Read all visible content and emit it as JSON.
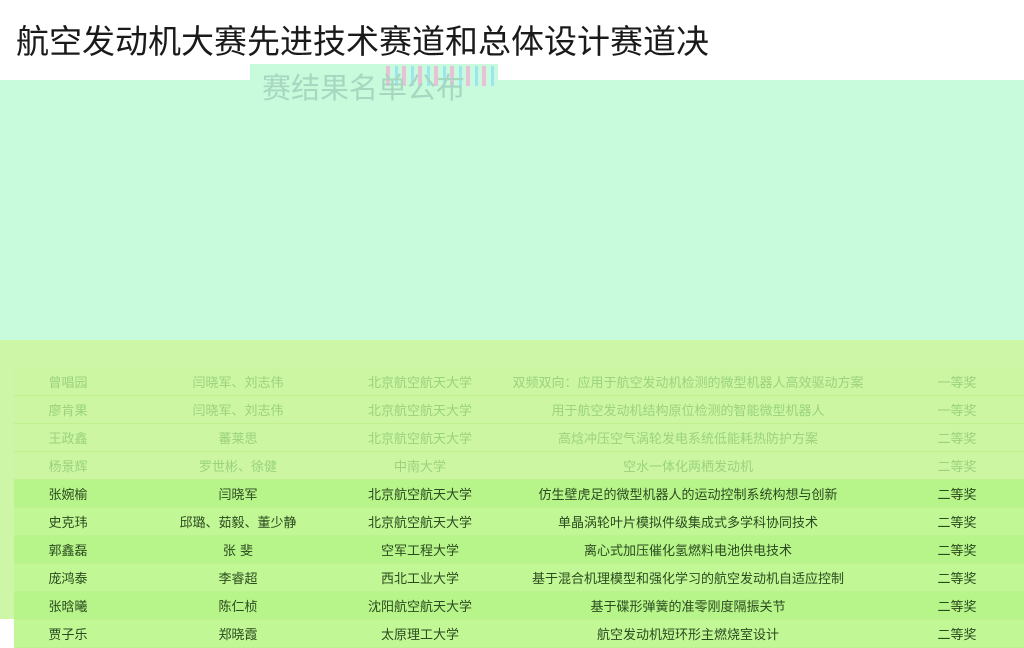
{
  "title": {
    "line1": "航空发动机大赛先进技术赛道和总体设计赛道决",
    "line2": "赛结果名单公布"
  },
  "overlay_title": "赛结果名单公布",
  "faded_row": {
    "name": "曾唱园",
    "advisors": "闫晓军、刘志伟",
    "school": "北京航空航天大学",
    "project": "双频双向：应用于航空发动机检测的微型机器人高效驱动方案",
    "award": "一等奖"
  },
  "table": {
    "rows": [
      {
        "name": "廖肯果",
        "advisors": "闫晓军、刘志伟",
        "school": "北京航空航天大学",
        "project": "用于航空发动机结构原位检测的智能微型机器人",
        "award": "一等奖",
        "style": "light"
      },
      {
        "name": "王政鑫",
        "advisors": "蕃莱思",
        "school": "北京航空航天大学",
        "project": "高焓冲压空气涡轮发电系统低能耗热防护方案",
        "award": "二等奖",
        "style": "light"
      },
      {
        "name": "杨景辉",
        "advisors": "罗世彬、徐健",
        "school": "中南大学",
        "project": "空水一体化两栖发动机",
        "award": "二等奖",
        "style": "light"
      },
      {
        "name": "张婉榆",
        "advisors": "闫晓军",
        "school": "北京航空航天大学",
        "project": "仿生壁虎足的微型机器人的运动控制系统构想与创新",
        "award": "二等奖",
        "style": "strong"
      },
      {
        "name": "史克玮",
        "advisors": "邱璐、茹毅、董少静",
        "school": "北京航空航天大学",
        "project": "单晶涡轮叶片模拟件级集成式多学科协同技术",
        "award": "二等奖",
        "style": "strong"
      },
      {
        "name": "郭鑫磊",
        "advisors": "张  斐",
        "school": "空军工程大学",
        "project": "离心式加压催化氢燃料电池供电技术",
        "award": "二等奖",
        "style": "strong"
      },
      {
        "name": "庞鸿泰",
        "advisors": "李睿超",
        "school": "西北工业大学",
        "project": "基于混合机理模型和强化学习的航空发动机自适应控制",
        "award": "二等奖",
        "style": "strong"
      },
      {
        "name": "张晗曦",
        "advisors": "陈仁桢",
        "school": "沈阳航空航天大学",
        "project": "基于碟形弹簧的准零刚度隔振关节",
        "award": "二等奖",
        "style": "strong"
      },
      {
        "name": "贾子乐",
        "advisors": "郑晓霞",
        "school": "太原理工大学",
        "project": "航空发动机短环形主燃烧室设计",
        "award": "二等奖",
        "style": "strong"
      }
    ]
  }
}
